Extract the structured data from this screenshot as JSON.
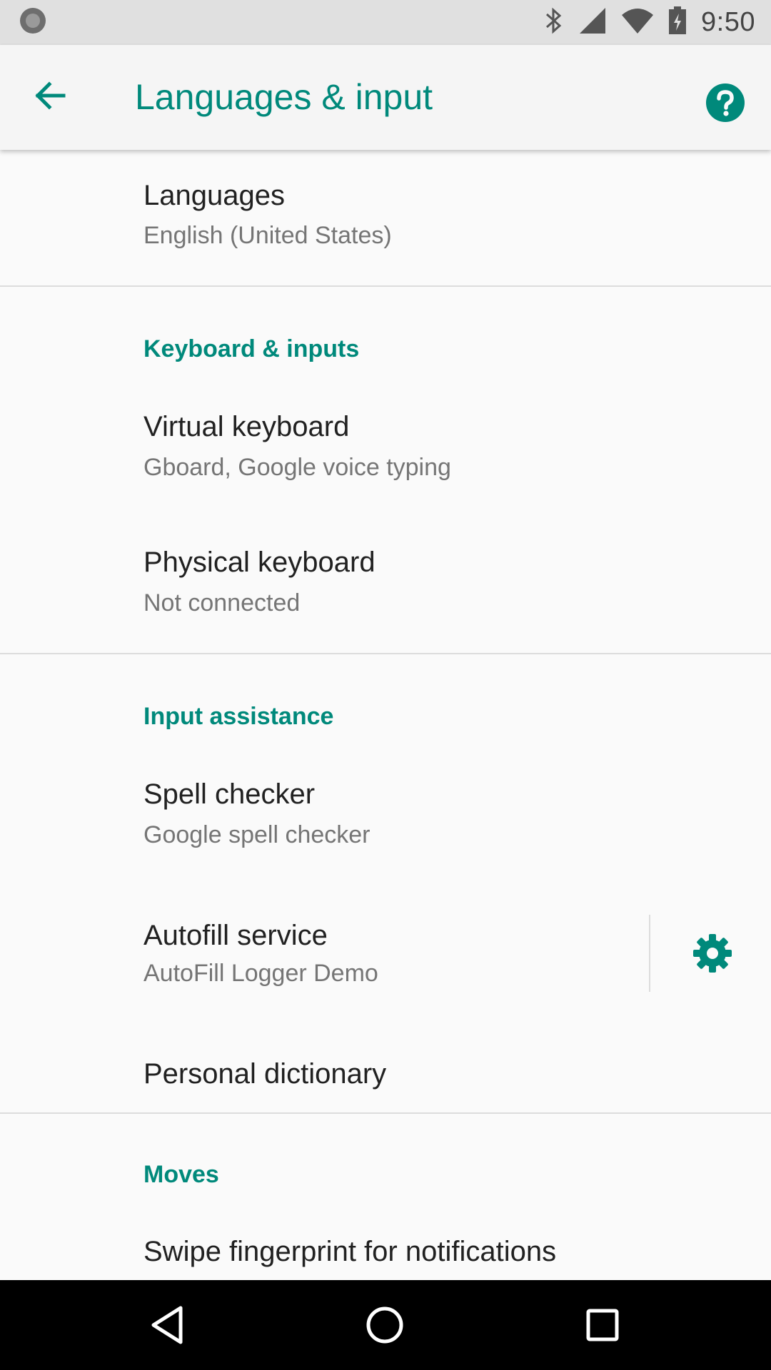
{
  "status_bar": {
    "time": "9:50",
    "icons": [
      "notification-dot-icon",
      "bluetooth-icon",
      "cellular-signal-icon",
      "wifi-icon",
      "battery-icon"
    ]
  },
  "app_bar": {
    "title": "Languages & input",
    "back_icon": "arrow-back-icon",
    "help_icon": "help-icon"
  },
  "languages": {
    "title": "Languages",
    "summary": "English (United States)"
  },
  "keyboard_section": {
    "header": "Keyboard & inputs",
    "items": [
      {
        "title": "Virtual keyboard",
        "summary": "Gboard, Google voice typing"
      },
      {
        "title": "Physical keyboard",
        "summary": "Not connected"
      }
    ]
  },
  "input_assistance_section": {
    "header": "Input assistance",
    "items": [
      {
        "title": "Spell checker",
        "summary": "Google spell checker"
      },
      {
        "title": "Autofill service",
        "summary": "AutoFill Logger Demo",
        "action_icon": "gear-icon"
      },
      {
        "title": "Personal dictionary"
      }
    ]
  },
  "moves_section": {
    "header": "Moves",
    "items": [
      {
        "title": "Swipe fingerprint for notifications"
      }
    ]
  },
  "nav_bar": {
    "icons": [
      "back-triangle-icon",
      "home-circle-icon",
      "recents-square-icon"
    ]
  },
  "colors": {
    "accent": "#00897b",
    "status_bar": "#e0e0e0",
    "app_bar": "#f5f5f5",
    "background": "#fafafa",
    "nav_bar": "#000000"
  }
}
